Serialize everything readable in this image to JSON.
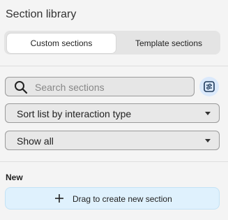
{
  "header": {
    "title": "Section library"
  },
  "tabs": [
    {
      "label": "Custom sections",
      "active": true
    },
    {
      "label": "Template sections",
      "active": false
    }
  ],
  "search": {
    "placeholder": "Search sections",
    "value": ""
  },
  "filters": {
    "sort_select": {
      "selected": "Sort list by interaction type"
    },
    "show_select": {
      "selected": "Show all"
    }
  },
  "new_section": {
    "heading": "New",
    "drag_label": "Drag to create new section"
  },
  "colors": {
    "background": "#f4f4f4",
    "tab_active": "#ffffff",
    "accent_light_blue": "#dff1fd",
    "filter_button": "#dbe9fb"
  },
  "icons": {
    "search": "search-icon",
    "filter": "filter-settings-icon",
    "caret": "chevron-down-icon",
    "plus": "plus-icon"
  }
}
